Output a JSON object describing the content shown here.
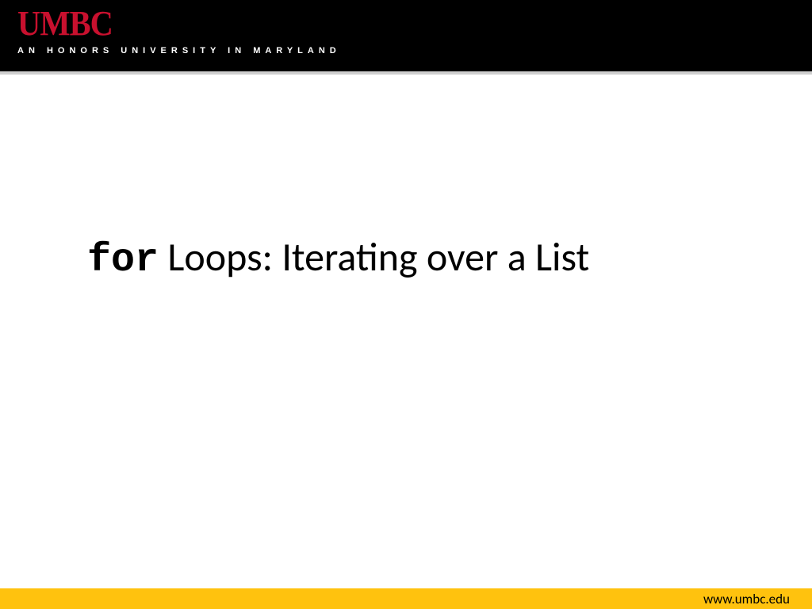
{
  "header": {
    "logo_text": "UMBC",
    "tagline": "AN HONORS UNIVERSITY IN MARYLAND"
  },
  "slide": {
    "title_code": "for",
    "title_rest": " Loops: Iterating over a List"
  },
  "footer": {
    "url": "www.umbc.edu"
  },
  "colors": {
    "logo_red": "#c8102e",
    "footer_yellow": "#ffc20e",
    "header_black": "#000000"
  }
}
